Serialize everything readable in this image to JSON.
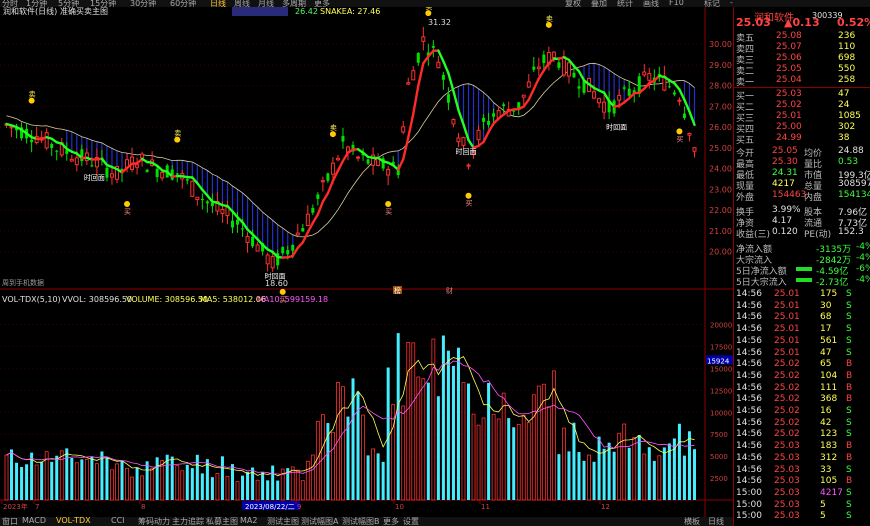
{
  "toolbar": {
    "tabs": [
      "分时",
      "1分钟",
      "5分钟",
      "15分钟",
      "30分钟",
      "60分钟",
      "日线",
      "周线",
      "月线",
      "多周期",
      "更多"
    ],
    "active": "日线",
    "right": [
      "复权",
      "叠加",
      "统计",
      "画线",
      "F10",
      "标记",
      "-"
    ]
  },
  "main_chart": {
    "title": "润和软件(日线)",
    "indicator": "准确买卖主图",
    "snakea_label": "SNAKEA: 27.46",
    "value_label": "26.42",
    "high_label": "31.32",
    "low_label": "18.60",
    "fullscreen_hint": "周到手机数据",
    "y_ticks": [
      "30.00",
      "29.00",
      "28.00",
      "27.00",
      "26.00",
      "25.00",
      "24.00",
      "23.00",
      "22.00",
      "21.00",
      "20.00"
    ],
    "signal_buy": "买",
    "signal_sell": "卖",
    "signal_b": "B",
    "signal_s": "S",
    "retreat_text": "时回面",
    "markers": [
      "榜",
      "财"
    ]
  },
  "vol_chart": {
    "title": "VOL-TDX(5,10)",
    "vvol": "VVOL: 308596.50",
    "volume": "VOLUME: 308596.50",
    "ma5": "MA5: 538012.06",
    "ma10": "MA10: 599159.18",
    "y_ticks": [
      "20000",
      "17500",
      "15000",
      "12500",
      "10000",
      "7500",
      "5000",
      "2500"
    ],
    "y_mark": "15924",
    "x_ticks": [
      "2023年",
      "7",
      "8",
      "2023/08/22/二",
      "9",
      "10",
      "11",
      "12"
    ]
  },
  "bottom_tabs": [
    "窗口",
    "MACD",
    "VOL-TDX",
    "CCI",
    "筹码动力",
    "主力追踪",
    "私募主图",
    "MA2",
    "测试主图",
    "测试幅图A",
    "测试幅图B",
    "更多",
    "设置"
  ],
  "bottom_active": "VOL-TDX",
  "bottom_right": [
    "横板",
    "日线"
  ],
  "quote": {
    "name": "润和软件",
    "code": "300339",
    "price": "25.03",
    "change": "▲0.13",
    "pct": "0.52%",
    "asks": [
      {
        "label": "卖五",
        "price": "25.08",
        "vol": "236"
      },
      {
        "label": "卖四",
        "price": "25.07",
        "vol": "110"
      },
      {
        "label": "卖三",
        "price": "25.06",
        "vol": "698"
      },
      {
        "label": "卖二",
        "price": "25.05",
        "vol": "550"
      },
      {
        "label": "卖一",
        "price": "25.04",
        "vol": "258"
      }
    ],
    "bids": [
      {
        "label": "买一",
        "price": "25.03",
        "vol": "47"
      },
      {
        "label": "买二",
        "price": "25.02",
        "vol": "24"
      },
      {
        "label": "买三",
        "price": "25.01",
        "vol": "1085"
      },
      {
        "label": "买四",
        "price": "25.00",
        "vol": "302"
      },
      {
        "label": "买五",
        "price": "24.99",
        "vol": "38"
      }
    ],
    "stats": [
      {
        "l1": "今开",
        "v1": "25.05",
        "l2": "均价",
        "v2": "24.88",
        "c1": "red",
        "c2": "wht"
      },
      {
        "l1": "最高",
        "v1": "25.30",
        "l2": "量比",
        "v2": "0.53",
        "c1": "red",
        "c2": "grn"
      },
      {
        "l1": "最低",
        "v1": "24.31",
        "l2": "市值",
        "v2": "199.3亿",
        "c1": "grn",
        "c2": "wht"
      },
      {
        "l1": "现量",
        "v1": "4217",
        "l2": "总量",
        "v2": "308597",
        "c1": "yel",
        "c2": "wht"
      },
      {
        "l1": "外盘",
        "v1": "154463",
        "l2": "内盘",
        "v2": "154134",
        "c1": "red",
        "c2": "grn"
      },
      {
        "l1": "换手",
        "v1": "3.99%",
        "l2": "股本",
        "v2": "7.96亿",
        "c1": "wht",
        "c2": "wht"
      },
      {
        "l1": "净资",
        "v1": "4.17",
        "l2": "流通",
        "v2": "7.73亿",
        "c1": "wht",
        "c2": "wht"
      },
      {
        "l1": "收益(三)",
        "v1": "0.120",
        "l2": "PE(动)",
        "v2": "152.3",
        "c1": "wht",
        "c2": "wht"
      }
    ],
    "flows": [
      {
        "label": "净流入额",
        "value": "-3135万",
        "pct": "-4%"
      },
      {
        "label": "大宗流入",
        "value": "-2842万",
        "pct": "-4%"
      },
      {
        "label": "5日净流入额",
        "value": "-4.59亿",
        "pct": "-6%"
      },
      {
        "label": "5日大宗流入",
        "value": "-2.73亿",
        "pct": "-4%"
      }
    ],
    "ticks": [
      {
        "t": "14:56",
        "p": "25.01",
        "v": "175",
        "d": "S"
      },
      {
        "t": "14:56",
        "p": "25.01",
        "v": "30",
        "d": "S"
      },
      {
        "t": "14:56",
        "p": "25.01",
        "v": "68",
        "d": "S"
      },
      {
        "t": "14:56",
        "p": "25.01",
        "v": "17",
        "d": "S"
      },
      {
        "t": "14:56",
        "p": "25.01",
        "v": "561",
        "d": "S"
      },
      {
        "t": "14:56",
        "p": "25.01",
        "v": "47",
        "d": "S"
      },
      {
        "t": "14:56",
        "p": "25.02",
        "v": "65",
        "d": "B"
      },
      {
        "t": "14:56",
        "p": "25.02",
        "v": "104",
        "d": "B"
      },
      {
        "t": "14:56",
        "p": "25.02",
        "v": "111",
        "d": "B"
      },
      {
        "t": "14:56",
        "p": "25.02",
        "v": "368",
        "d": "B"
      },
      {
        "t": "14:56",
        "p": "25.02",
        "v": "16",
        "d": "S"
      },
      {
        "t": "14:56",
        "p": "25.02",
        "v": "42",
        "d": "S"
      },
      {
        "t": "14:56",
        "p": "25.02",
        "v": "123",
        "d": "S"
      },
      {
        "t": "14:56",
        "p": "25.03",
        "v": "183",
        "d": "B"
      },
      {
        "t": "14:56",
        "p": "25.03",
        "v": "312",
        "d": "B"
      },
      {
        "t": "14:56",
        "p": "25.03",
        "v": "33",
        "d": "S"
      },
      {
        "t": "14:56",
        "p": "25.03",
        "v": "105",
        "d": "B"
      },
      {
        "t": "15:00",
        "p": "25.03",
        "v": "4217",
        "d": "S"
      },
      {
        "t": "15:00",
        "p": "25.03",
        "v": "5",
        "d": "S"
      },
      {
        "t": "15:00",
        "p": "25.03",
        "v": "5",
        "d": "S"
      }
    ]
  }
}
